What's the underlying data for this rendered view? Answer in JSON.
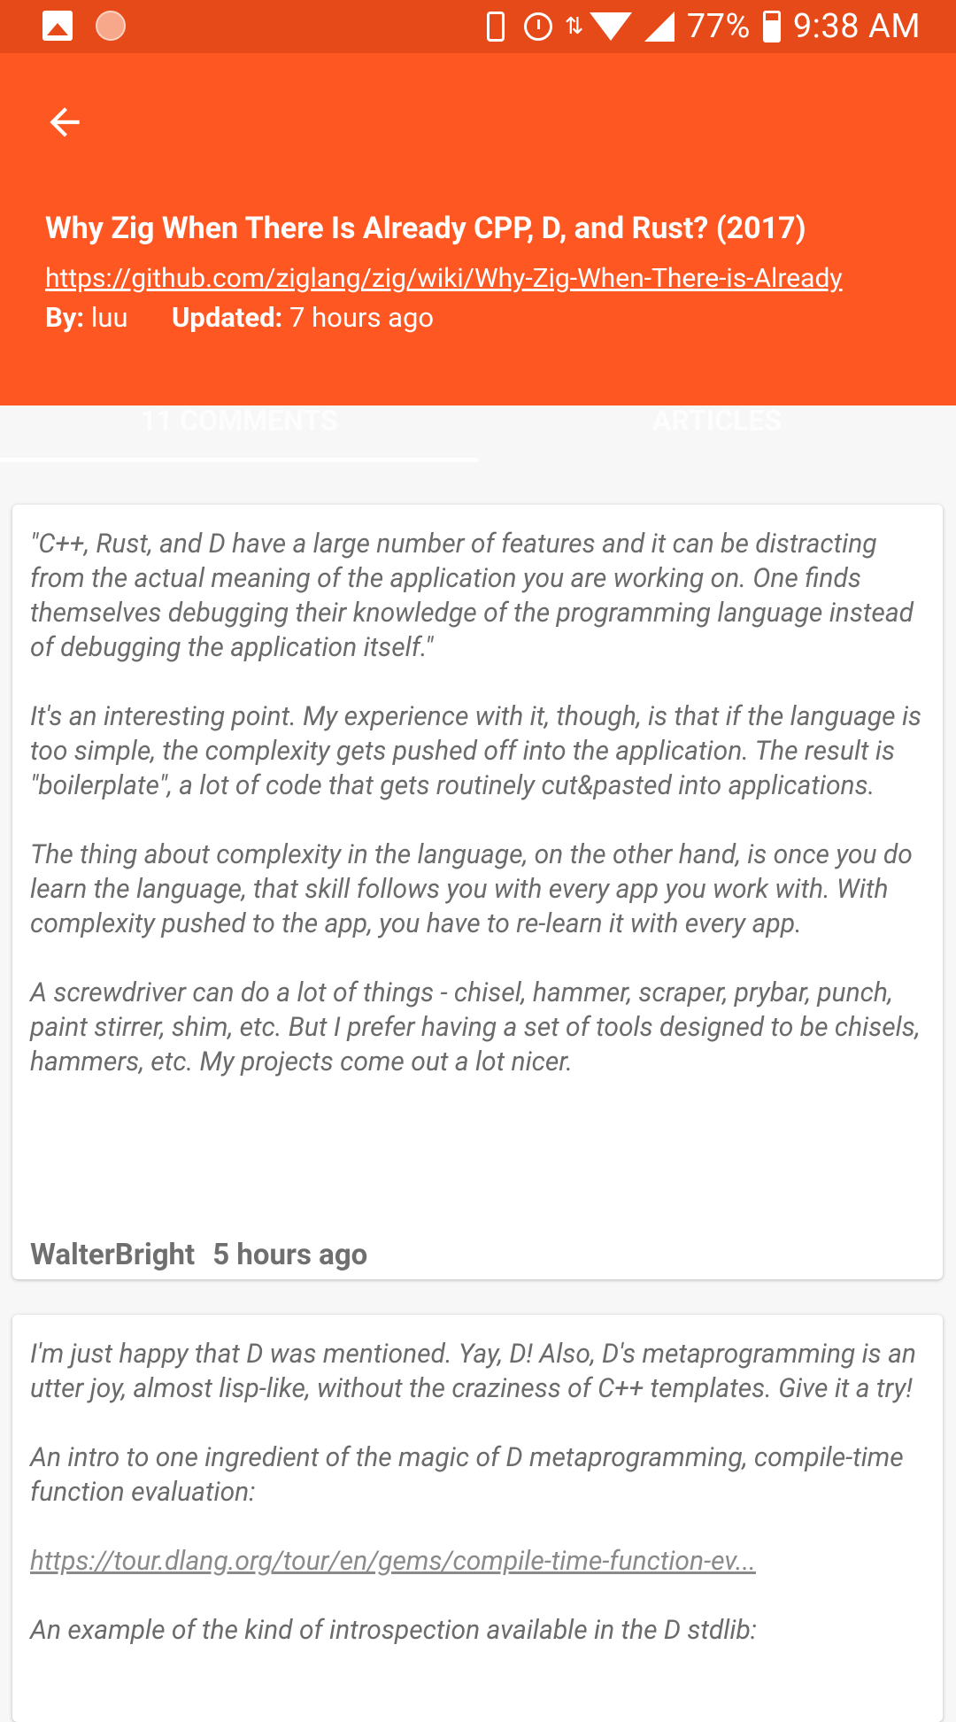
{
  "status_bar": {
    "battery": "77%",
    "time": "9:38 AM"
  },
  "header": {
    "title": "Why Zig When There Is Already CPP, D, and Rust? (2017)",
    "url": "https://github.com/ziglang/zig/wiki/Why-Zig-When-There-is-Already",
    "by_label": "By:",
    "author": "luu",
    "updated_label": "Updated:",
    "updated_value": "7 hours ago"
  },
  "tabs": [
    {
      "label": "11 COMMENTS",
      "active": true
    },
    {
      "label": "ARTICLES",
      "active": false
    }
  ],
  "comments": [
    {
      "paragraphs": [
        "\"C++, Rust, and D have a large number of features and it can be distracting from the actual meaning of the application you are working on. One finds themselves debugging their knowledge of the programming language instead of debugging the application itself.\"",
        "It's an interesting point. My experience with it, though, is that if the language is too simple, the complexity gets pushed off into the application. The result is \"boilerplate\", a lot of code that gets routinely cut&pasted into applications.",
        "The thing about complexity in the language, on the other hand, is once you do learn the language, that skill follows you with every app you work with. With complexity pushed to the app, you have to re-learn it with every app.",
        "A screwdriver can do a lot of things - chisel, hammer, scraper, prybar, punch, paint stirrer, shim, etc. But I prefer having a set of tools designed to be chisels, hammers, etc. My projects come out a lot nicer."
      ],
      "author": "WalterBright",
      "time": "5 hours ago"
    },
    {
      "paragraphs": [
        "I'm just happy that D was mentioned. Yay, D! Also, D's metaprogramming is an utter joy, almost lisp-like, without the craziness of C++ templates. Give it a try!",
        "An intro to one ingredient of the magic of D metaprogramming, compile-time function evaluation:"
      ],
      "link": "https://tour.dlang.org/tour/en/gems/compile-time-function-ev...",
      "trailing": "An example of the kind of introspection available in the D stdlib:"
    }
  ]
}
